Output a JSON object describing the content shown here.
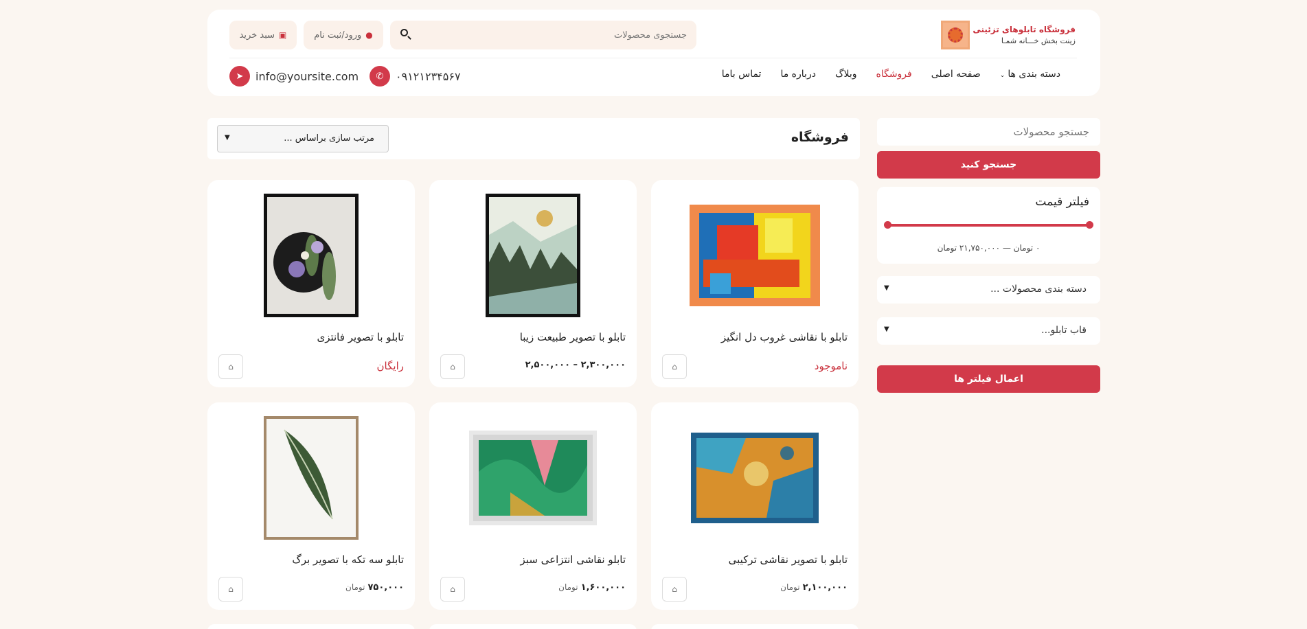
{
  "brand": {
    "title": "فروشگاه تابلوهای تزئینی",
    "subtitle": "زینت بخش خـــانه شمـا"
  },
  "header": {
    "search_placeholder": "جستجوی محصولات",
    "login_label": "ورود/ثبت نام",
    "cart_label": "سبد خرید",
    "nav": [
      "دسته بندی ها",
      "صفحه اصلی",
      "فروشگاه",
      "وبلاگ",
      "درباره ما",
      "تماس باما"
    ],
    "phone": "۰۹۱۲۱۲۳۴۵۶۷",
    "email": "info@yoursite.com"
  },
  "sidebar": {
    "search_placeholder": "جستجو محصولات",
    "search_button": "جستجو کنید",
    "price_filter_title": "فیلتر قیمت",
    "price_range": "۰ تومان — ۲۱,۷۵۰,۰۰۰ تومان",
    "price_min": 0,
    "price_max": 21750000,
    "category_dropdown": "دسته بندی محصولات ...",
    "frame_dropdown": "قاب تابلو...",
    "apply_button": "اعمال فیلتر ها"
  },
  "shop": {
    "title": "فروشگاه",
    "sort_label": "مرتب سازی براساس ..."
  },
  "products": [
    {
      "title": "تابلو با نقاشی غروب دل انگیز",
      "price": "ناموجود",
      "currency": "",
      "price_style": "red"
    },
    {
      "title": "تابلو با تصویر طبیعت زیبا",
      "price": "۲,۳۰۰,۰۰۰ – ۲,۵۰۰,۰۰۰",
      "currency": "",
      "price_style": "normal"
    },
    {
      "title": "تابلو با تصویر فانتزی",
      "price": "رایگان",
      "currency": "",
      "price_style": "red"
    },
    {
      "title": "تابلو با تصویر نقاشی ترکیبی",
      "price": "۲,۱۰۰,۰۰۰",
      "currency": "تومان",
      "price_style": "normal"
    },
    {
      "title": "تابلو نقاشی انتزاعی سبز",
      "price": "۱,۶۰۰,۰۰۰",
      "currency": "تومان",
      "price_style": "normal"
    },
    {
      "title": "تابلو سه تکه با تصویر برگ",
      "price": "۷۵۰,۰۰۰",
      "currency": "تومان",
      "price_style": "normal"
    }
  ],
  "colors": {
    "accent": "#d23a4a",
    "background": "#fbf6f1",
    "card": "#ffffff"
  }
}
